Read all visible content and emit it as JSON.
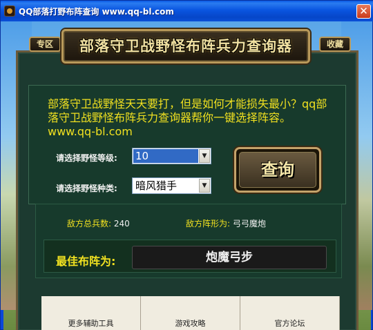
{
  "window": {
    "title": "QQ部落打野布阵查询 www.qq-bl.com",
    "close_glyph": "✕"
  },
  "header": {
    "title": "部落守卫战野怪布阵兵力查询器",
    "left_button": "专区",
    "right_button": "收藏"
  },
  "intro_text": "部落守卫战野怪天天要打，但是如何才能损失最小？qq部落守卫战野怪布阵兵力查询器帮你一键选择阵容。  www.qq-bl.com",
  "form": {
    "level_label": "请选择野怪等级:",
    "level_value": "10",
    "type_label": "请选择野怪种类:",
    "type_value": "暗风猎手",
    "query_button": "查询"
  },
  "result": {
    "total_troops_label": "敌方总兵数:",
    "total_troops_value": "240",
    "formation_label": "敌方阵形为:",
    "formation_value": "弓弓魔炮",
    "best_label": "最佳布阵为:",
    "best_value": "炮魔弓步"
  },
  "bottom_buttons": [
    "更多辅助工具",
    "游戏攻略",
    "官方论坛"
  ]
}
